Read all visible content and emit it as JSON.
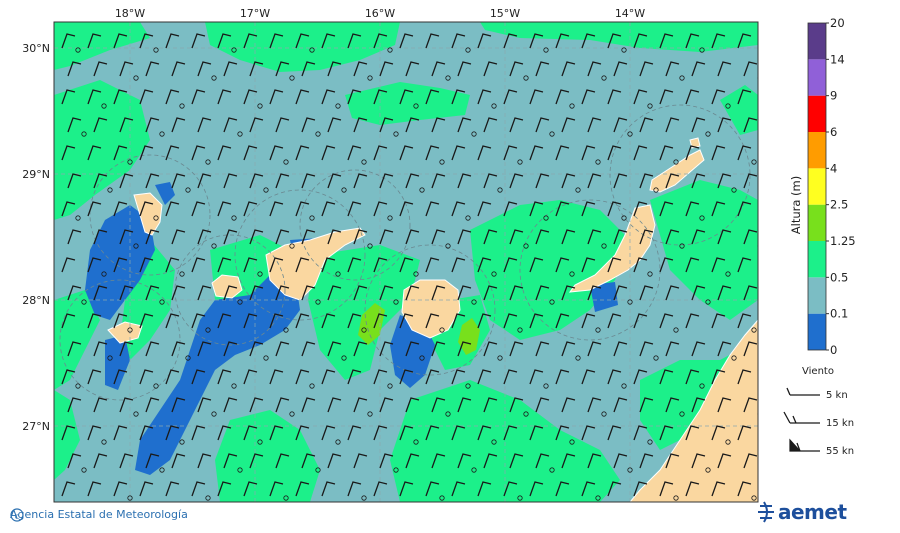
{
  "map": {
    "lon_ticks": [
      "18°W",
      "17°W",
      "16°W",
      "15°W",
      "14°W"
    ],
    "lat_ticks": [
      "30°N",
      "29°N",
      "28°N",
      "27°N"
    ]
  },
  "colorbar": {
    "title": "Altura (m)",
    "levels": [
      "0",
      "0.1",
      "0.5",
      "1.25",
      "2.5",
      "4",
      "6",
      "9",
      "14",
      "20"
    ],
    "colors": [
      "#1f6fce",
      "#7bbdc4",
      "#1cf08a",
      "#78e01c",
      "#ffff20",
      "#ff9c00",
      "#ff0000",
      "#9060d8",
      "#5a3c8a"
    ]
  },
  "legend": {
    "title": "Viento",
    "items": [
      "5 kn",
      "15 kn",
      "55 kn"
    ]
  },
  "colors": {
    "land": "#fad7a0",
    "sea_low": "#7bbdc4",
    "sea_mid": "#1cf08a",
    "sea_deep": "#1f6fce"
  },
  "footer": {
    "copyright": "Agencia Estatal de Meteorología",
    "logo": "aemet"
  }
}
